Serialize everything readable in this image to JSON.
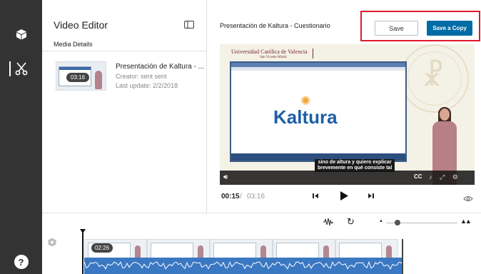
{
  "rail": {
    "items": [
      {
        "icon": "cube-icon"
      },
      {
        "icon": "scissors-icon"
      }
    ],
    "help_label": "?"
  },
  "info_panel": {
    "title": "Video Editor",
    "subtitle": "Media Details",
    "entry": {
      "duration": "03:16",
      "title": "Presentación de Kaltura - ...",
      "creator": "Creator: sent sent",
      "last_update": "Last update: 2/2/2018"
    }
  },
  "preview": {
    "title": "Presentación de Kaltura - Cuestionario",
    "save_label": "Save",
    "save_copy_label": "Save a Copy",
    "highlight_color": "#e0192a",
    "accent_color": "#006ca6",
    "video": {
      "university": "Universidad Católica de Valencia",
      "university_sub": "San Vicente Mártir",
      "brand": "Kaltura",
      "subtitle_line1": "sino de altura y quiero explicar",
      "subtitle_line2": "brevemente en qué consiste tal",
      "cc_label": "CC"
    },
    "current_time": "00:15",
    "time_separator": "/",
    "total_time": "03:16"
  },
  "timeline": {
    "playhead_time": "02:26"
  }
}
